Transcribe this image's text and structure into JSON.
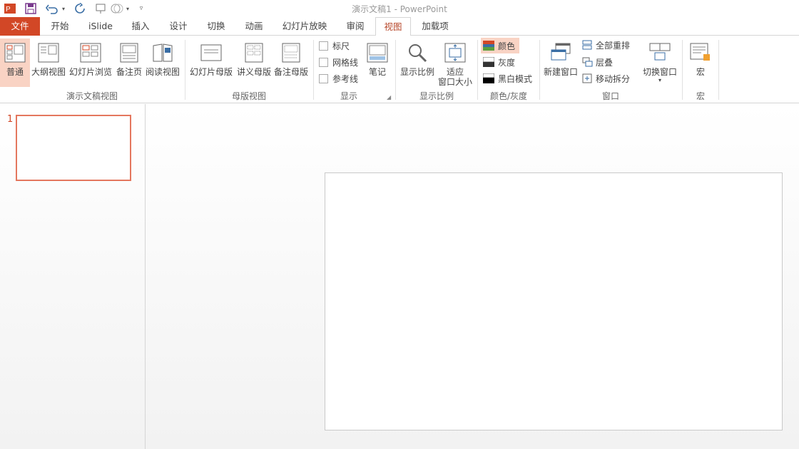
{
  "window": {
    "title": "演示文稿1 - PowerPoint"
  },
  "quick_access": {
    "app_icon": "powerpoint-app-icon",
    "save_icon": "save-icon",
    "undo_icon": "undo-icon",
    "redo_icon": "redo-icon",
    "present_icon": "start-from-beginning-icon",
    "customize_icon": "customize-toolbar-icon"
  },
  "tabs": [
    "文件",
    "开始",
    "iSlide",
    "插入",
    "设计",
    "切换",
    "动画",
    "幻灯片放映",
    "审阅",
    "视图",
    "加载项"
  ],
  "active_tab": "视图",
  "ribbon": {
    "presentation_views": {
      "label": "演示文稿视图",
      "buttons": [
        "普通",
        "大纲视图",
        "幻灯片浏览",
        "备注页",
        "阅读视图"
      ]
    },
    "master_views": {
      "label": "母版视图",
      "buttons": [
        "幻灯片母版",
        "讲义母版",
        "备注母版"
      ]
    },
    "show": {
      "label": "显示",
      "checkboxes": [
        "标尺",
        "网格线",
        "参考线"
      ],
      "notes_button": "笔记"
    },
    "zoom": {
      "label": "显示比例",
      "zoom_button": "显示比例",
      "fit_button_line1": "适应",
      "fit_button_line2": "窗口大小"
    },
    "color": {
      "label": "颜色/灰度",
      "items": [
        "颜色",
        "灰度",
        "黑白模式"
      ]
    },
    "window": {
      "label": "窗口",
      "new_window": "新建窗口",
      "items": [
        "全部重排",
        "层叠",
        "移动拆分"
      ],
      "switch_window": "切换窗口"
    },
    "macros": {
      "label": "宏",
      "button": "宏"
    }
  },
  "thumbnails": {
    "slide_number": "1"
  },
  "colors": {
    "accent": "#d24726",
    "active_tab_text": "#b7472a",
    "selected_bg": "#f9d3c4"
  }
}
